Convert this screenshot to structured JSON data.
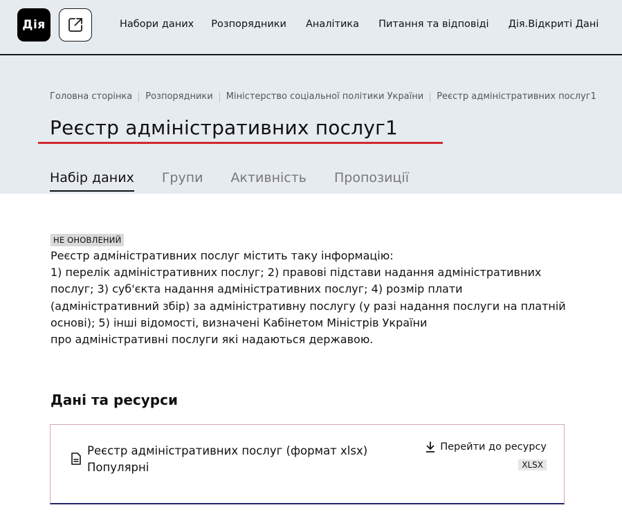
{
  "header": {
    "logo_text": "Дія",
    "external_icon": "external-link-icon",
    "nav": [
      {
        "label": "Набори даних"
      },
      {
        "label": "Розпорядники"
      },
      {
        "label": "Аналітика"
      },
      {
        "label": "Питання та відповіді"
      },
      {
        "label": "Дія.Відкриті Дані"
      }
    ]
  },
  "breadcrumb": [
    {
      "label": "Головна сторінка"
    },
    {
      "label": "Розпорядники"
    },
    {
      "label": "Міністерство соціальної політики України"
    },
    {
      "label": "Реєстр адміністративних послуг1"
    }
  ],
  "page": {
    "title": "Реєстр адміністративних послуг1",
    "accent_color": "#d0282e",
    "tabs": [
      {
        "label": "Набір даних",
        "active": true
      },
      {
        "label": "Групи",
        "active": false
      },
      {
        "label": "Активність",
        "active": false
      },
      {
        "label": "Пропозиції",
        "active": false
      }
    ]
  },
  "dataset": {
    "status_badge": "НЕ ОНОВЛЕНИЙ",
    "description": "Реєстр адміністративних послуг містить таку інформацію:\n1) перелік адміністративних послуг; 2) правові підстави надання адміністративних послуг; 3) суб'єкта надання адміністративних послуг; 4) розмір плати (адміністративний збір) за адміністративну послугу (у разі надання послуги на платній основі); 5) інші відомості, визначені Кабінетом Міністрів України\nпро адміністративні послуги які надаються державою.",
    "resources_title": "Дані та ресурси",
    "resources": [
      {
        "name": "Реєстр адміністративних послуг (формат xlsx)",
        "tag": "Популярні",
        "action_label": "Перейти до ресурсу",
        "format": "XLSX",
        "icon": "file-icon",
        "action_icon": "download-icon"
      }
    ]
  }
}
